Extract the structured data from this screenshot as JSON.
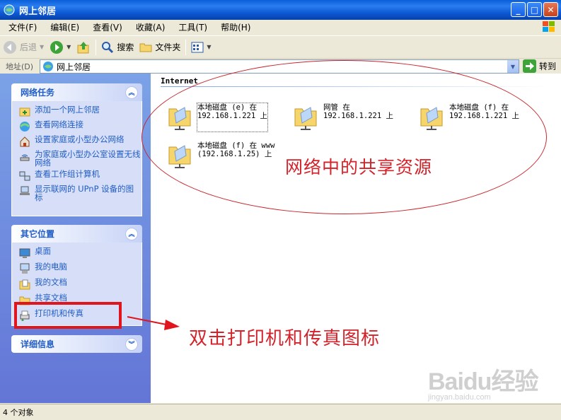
{
  "window": {
    "title": "网上邻居"
  },
  "menu": [
    "文件(F)",
    "编辑(E)",
    "查看(V)",
    "收藏(A)",
    "工具(T)",
    "帮助(H)"
  ],
  "toolbar": {
    "back": "后退",
    "search": "搜索",
    "folders": "文件夹"
  },
  "address": {
    "label": "地址(D)",
    "value": "网上邻居",
    "go": "转到"
  },
  "left_panels": [
    {
      "title": "网络任务",
      "items": [
        "添加一个网上邻居",
        "查看网络连接",
        "设置家庭或小型办公网络",
        "为家庭或小型办公室设置无线网络",
        "查看工作组计算机",
        "显示联网的 UPnP 设备的图标"
      ]
    },
    {
      "title": "其它位置",
      "items": [
        "桌面",
        "我的电脑",
        "我的文档",
        "共享文档",
        "打印机和传真"
      ]
    },
    {
      "title": "详细信息",
      "items": []
    }
  ],
  "content": {
    "group": "Internet",
    "shares": [
      {
        "line1": "本地磁盘 (e) 在",
        "line2": "192.168.1.221 上"
      },
      {
        "line1": "网管 在",
        "line2": "192.168.1.221 上"
      },
      {
        "line1": "本地磁盘 (f) 在",
        "line2": "192.168.1.221 上"
      },
      {
        "line1": "本地磁盘 (f) 在 www",
        "line2": "(192.168.1.25) 上"
      }
    ]
  },
  "annotations": {
    "shared_resources": "网络中的共享资源",
    "double_click_hint": "双击打印机和传真图标"
  },
  "status": {
    "text": "4 个对象"
  },
  "watermark": {
    "main": "Baidu经验",
    "sub": "jingyan.baidu.com"
  },
  "colors": {
    "link_blue": "#215dc6",
    "annotation_red": "#d4222a",
    "title_blue": "#0a5fd8"
  }
}
